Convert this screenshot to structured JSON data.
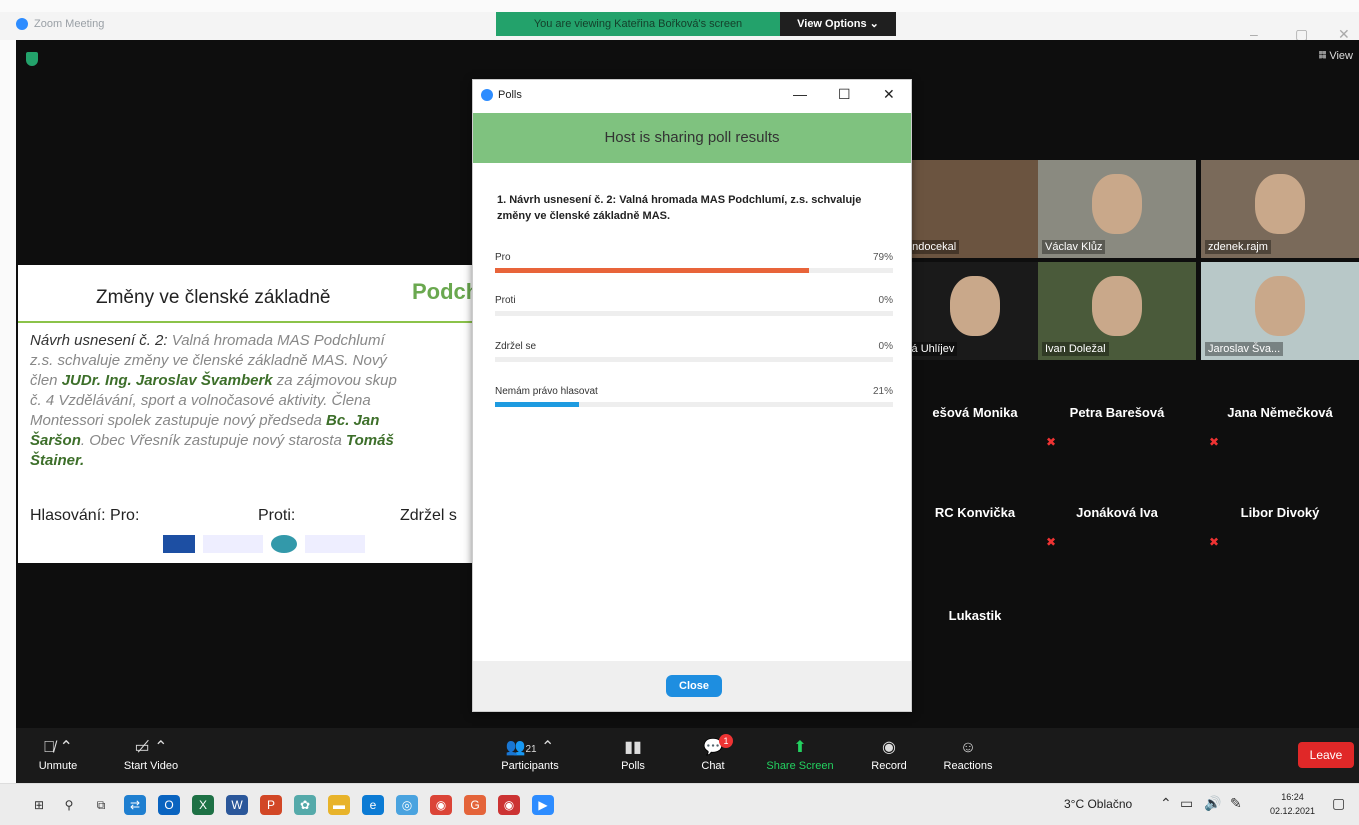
{
  "window": {
    "app_title": "Zoom Meeting",
    "share_banner": "You are viewing Kateřina Bořková's screen",
    "view_options": "View Options ⌄",
    "minimize": "–",
    "maximize": "▢",
    "close": "✕",
    "view_label": "𝄜 View"
  },
  "slide": {
    "title": "Změny ve členské základně",
    "logo_text": "Podch",
    "lead": "Návrh usnesení č. 2:",
    "line1": " Valná hromada MAS Podchlumí",
    "line2": "z.s. schvaluje změny ve členské základně MAS. Nový",
    "line3a": "člen ",
    "member": "JUDr. Ing. Jaroslav Švamberk",
    "line3b": " za zájmovou skup",
    "line4": "č. 4 Vzdělávání, sport a volnočasové aktivity. Člena",
    "line5a": "Montessori spolek zastupuje nový předseda ",
    "chair": "Bc. Jan",
    "chair2": "Šaršon",
    "line6": ". Obec Vřesník zastupuje nový starosta ",
    "mayor": "Tomáš",
    "mayor2": "Štainer.",
    "vote_for": "Hlasování: Pro:",
    "vote_against": "Proti:",
    "vote_abstain": "Zdržel s"
  },
  "participants": [
    {
      "label": "rtindocekal",
      "type": "video"
    },
    {
      "label": "Václav Klůz",
      "type": "video"
    },
    {
      "label": "zdenek.rajm",
      "type": "video"
    },
    {
      "label": "Ivá Uhlíjev",
      "type": "video"
    },
    {
      "label": "Ivan Doležal",
      "type": "video"
    },
    {
      "label": "Jaroslav Šva...",
      "type": "video"
    },
    {
      "label": "ešová Monika",
      "type": "name"
    },
    {
      "label": "Petra Barešová",
      "type": "name"
    },
    {
      "label": "Jana Němečková",
      "type": "name"
    },
    {
      "label": "RC Konvička",
      "type": "name"
    },
    {
      "label": "Jonáková Iva",
      "type": "name"
    },
    {
      "label": "Libor Divoký",
      "type": "name"
    },
    {
      "label": "Lukastik",
      "type": "name"
    }
  ],
  "polls": {
    "title": "Polls",
    "banner": "Host is sharing poll results",
    "question": "1. Návrh usnesení č. 2: Valná hromada MAS Podchlumí, z.s. schvaluje změny ve členské základně MAS.",
    "options": [
      {
        "label": "Pro",
        "pct": "79%",
        "value": 79,
        "color": "#e8643a"
      },
      {
        "label": "Proti",
        "pct": "0%",
        "value": 0,
        "color": "#1e9be0"
      },
      {
        "label": "Zdržel se",
        "pct": "0%",
        "value": 0,
        "color": "#1e9be0"
      },
      {
        "label": "Nemám právo hlasovat",
        "pct": "21%",
        "value": 21,
        "color": "#1e9be0"
      }
    ],
    "close_label": "Close"
  },
  "toolbar": {
    "unmute": "Unmute",
    "start_video": "Start Video",
    "participants": "Participants",
    "participants_count": "21",
    "polls": "Polls",
    "chat": "Chat",
    "chat_badge": "1",
    "share_screen": "Share Screen",
    "record": "Record",
    "reactions": "Reactions",
    "leave": "Leave"
  },
  "taskbar": {
    "weather": "3°C Oblačno",
    "time": "16:24",
    "date": "02.12.2021"
  }
}
